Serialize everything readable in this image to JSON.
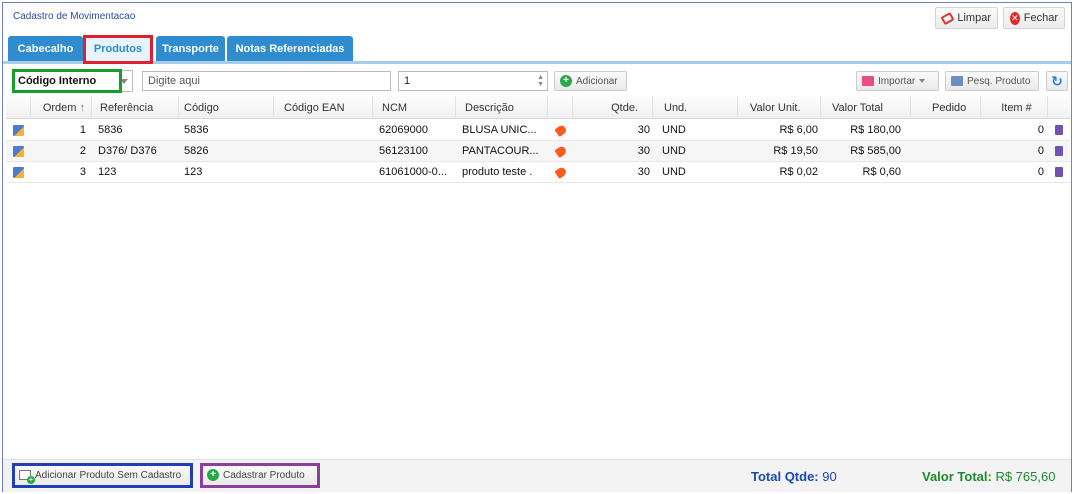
{
  "window": {
    "title": "Cadastro de Movimentacao"
  },
  "titlebar": {
    "limpar_label": "Limpar",
    "fechar_label": "Fechar"
  },
  "tabs": [
    {
      "label": "Cabecalho"
    },
    {
      "label": "Produtos"
    },
    {
      "label": "Transporte"
    },
    {
      "label": "Notas Referenciadas"
    }
  ],
  "toolbar": {
    "search_type": "Código Interno",
    "search_placeholder": "Digite aqui",
    "quantity_value": "1",
    "add_label": "Adicionar",
    "import_label": "Importar",
    "pesq_label": "Pesq. Produto"
  },
  "grid": {
    "headers": {
      "ordem": "Ordem",
      "referencia": "Referência",
      "codigo": "Código",
      "codigo_ean": "Código EAN",
      "ncm": "NCM",
      "descricao": "Descrição",
      "qtde": "Qtde.",
      "und": "Und.",
      "valor_unit": "Valor Unit.",
      "valor_total": "Valor Total",
      "pedido": "Pedido",
      "item": "Item #"
    },
    "sort_indicator": "↑",
    "rows": [
      {
        "ordem": "1",
        "referencia": "5836",
        "codigo": "5836",
        "codigo_ean": "",
        "ncm": "62069000",
        "descricao": "BLUSA UNIC...",
        "qtde": "30",
        "und": "UND",
        "valor_unit": "R$ 6,00",
        "valor_total": "R$ 180,00",
        "pedido": "",
        "item": "0"
      },
      {
        "ordem": "2",
        "referencia": "D376/ D376",
        "codigo": "5826",
        "codigo_ean": "",
        "ncm": "56123100",
        "descricao": "PANTACOUR...",
        "qtde": "30",
        "und": "UND",
        "valor_unit": "R$ 19,50",
        "valor_total": "R$ 585,00",
        "pedido": "",
        "item": "0"
      },
      {
        "ordem": "3",
        "referencia": "123",
        "codigo": "123",
        "codigo_ean": "",
        "ncm": "61061000-0...",
        "descricao": "produto teste .",
        "qtde": "30",
        "und": "UND",
        "valor_unit": "R$ 0,02",
        "valor_total": "R$ 0,60",
        "pedido": "",
        "item": "0"
      }
    ]
  },
  "footer": {
    "add_no_register_label": "Adicionar Produto Sem Cadastro",
    "register_label": "Cadastrar Produto",
    "total_qtde_label": "Total Qtde:",
    "total_qtde_value": "90",
    "valor_total_label": "Valor Total:",
    "valor_total_value": "R$ 765,60"
  },
  "colors": {
    "tab_blue": "#2e8ccf",
    "highlight_red": "#e02030",
    "highlight_green": "#14a02a",
    "highlight_blue": "#1e3fb5",
    "highlight_purple": "#8a3f9a"
  }
}
